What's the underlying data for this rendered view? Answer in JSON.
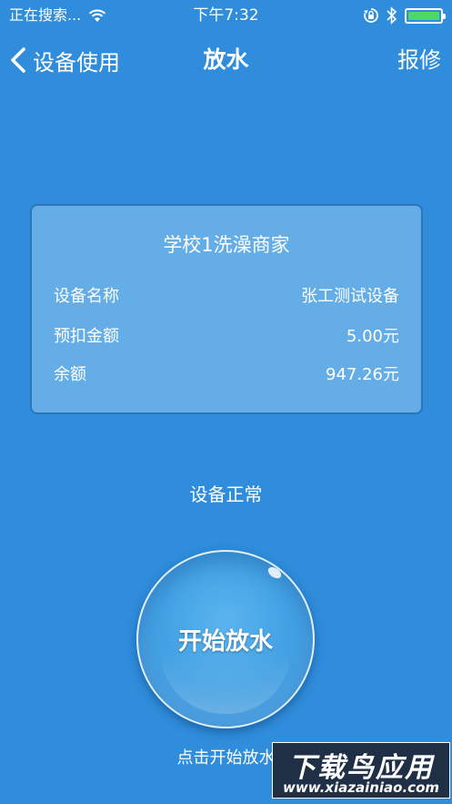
{
  "status_bar": {
    "carrier": "正在搜索...",
    "time": "下午7:32",
    "battery_level": 1.0
  },
  "nav": {
    "back_label": "设备使用",
    "title": "放水",
    "action_label": "报修"
  },
  "card": {
    "title": "学校1洗澡商家",
    "rows": [
      {
        "label": "设备名称",
        "value": "张工测试设备"
      },
      {
        "label": "预扣金额",
        "value": "5.00元"
      },
      {
        "label": "余额",
        "value": "947.26元"
      }
    ]
  },
  "device_status": "设备正常",
  "start_button_label": "开始放水",
  "hint": "点击开始放水",
  "watermark": {
    "top": "下载鸟应用",
    "bottom": "www.xiazainiao.com"
  },
  "colors": {
    "background": "#2f8ddb",
    "card": "#64ade6",
    "battery": "#4cd964"
  }
}
